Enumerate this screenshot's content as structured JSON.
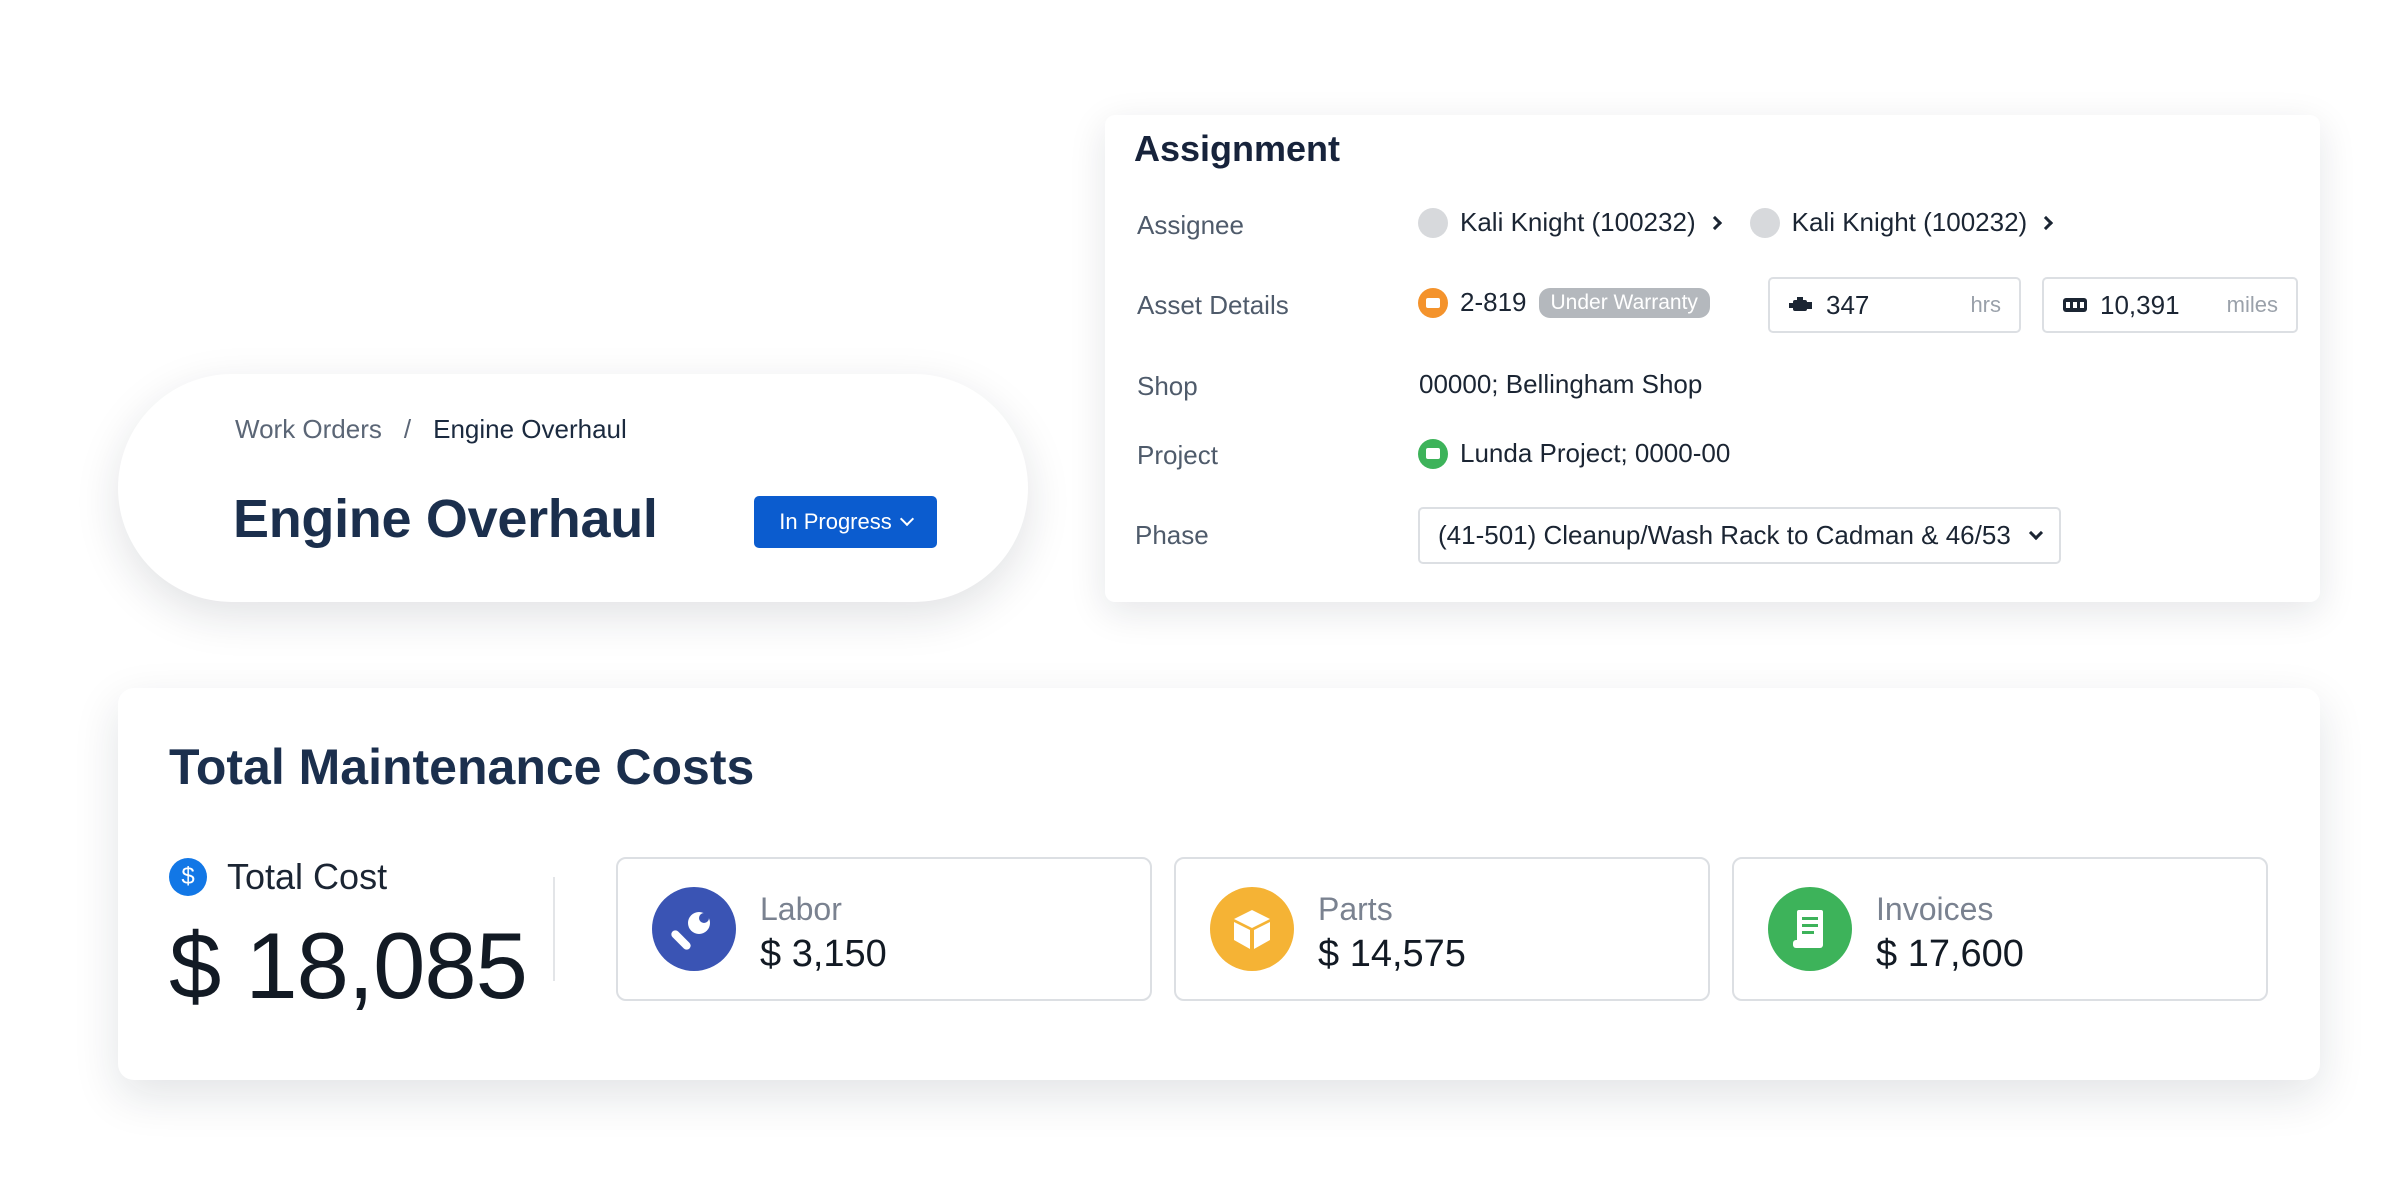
{
  "breadcrumb": {
    "parent": "Work Orders",
    "separator": "/",
    "current": "Engine Overhaul"
  },
  "header": {
    "title": "Engine Overhaul",
    "status": "In Progress"
  },
  "assignment": {
    "title": "Assignment",
    "labels": {
      "assignee": "Assignee",
      "asset_details": "Asset Details",
      "shop": "Shop",
      "project": "Project",
      "phase": "Phase"
    },
    "assignees": [
      "Kali Knight (100232)",
      "Kali Knight (100232)"
    ],
    "asset": {
      "id": "2-819",
      "badge": "Under Warranty"
    },
    "meters": [
      {
        "icon": "engine-icon",
        "value": "347",
        "unit": "hrs"
      },
      {
        "icon": "odometer-icon",
        "value": "10,391",
        "unit": "miles"
      }
    ],
    "shop": "00000; Bellingham Shop",
    "project": "Lunda Project; 0000-00",
    "phase": "(41-501) Cleanup/Wash Rack to Cadman & 46/53"
  },
  "costs": {
    "title": "Total Maintenance Costs",
    "total_label": "Total Cost",
    "total_value": "$ 18,085",
    "tiles": [
      {
        "label": "Labor",
        "value": "$ 3,150",
        "icon": "wrench-icon",
        "color": "#3a54b4"
      },
      {
        "label": "Parts",
        "value": "$ 14,575",
        "icon": "box-icon",
        "color": "#f5b335"
      },
      {
        "label": "Invoices",
        "value": "$ 17,600",
        "icon": "receipt-icon",
        "color": "#3db35a"
      }
    ]
  },
  "colors": {
    "primary": "#0b5ccf",
    "title": "#1b2f4d",
    "asset_orange": "#f4932c",
    "project_green": "#3db35a",
    "badge_gray": "#b4b8bd",
    "dollar_blue": "#1277e6"
  }
}
